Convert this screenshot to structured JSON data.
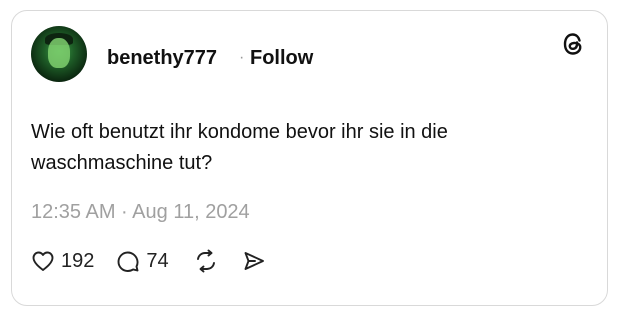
{
  "post": {
    "username": "benethy777",
    "separator": "·",
    "follow_label": "Follow",
    "text": "Wie oft benutzt ihr kondome bevor ihr sie in die waschmaschine tut?",
    "timestamp": "12:35 AM · Aug 11, 2024"
  },
  "actions": {
    "likes": "192",
    "replies": "74"
  },
  "icons": {
    "brand": "threads-logo-icon",
    "like": "heart-icon",
    "reply": "comment-icon",
    "repost": "repost-icon",
    "share": "send-icon"
  },
  "colors": {
    "text": "#111111",
    "muted": "#a0a0a0",
    "border": "#d9d9d9"
  }
}
